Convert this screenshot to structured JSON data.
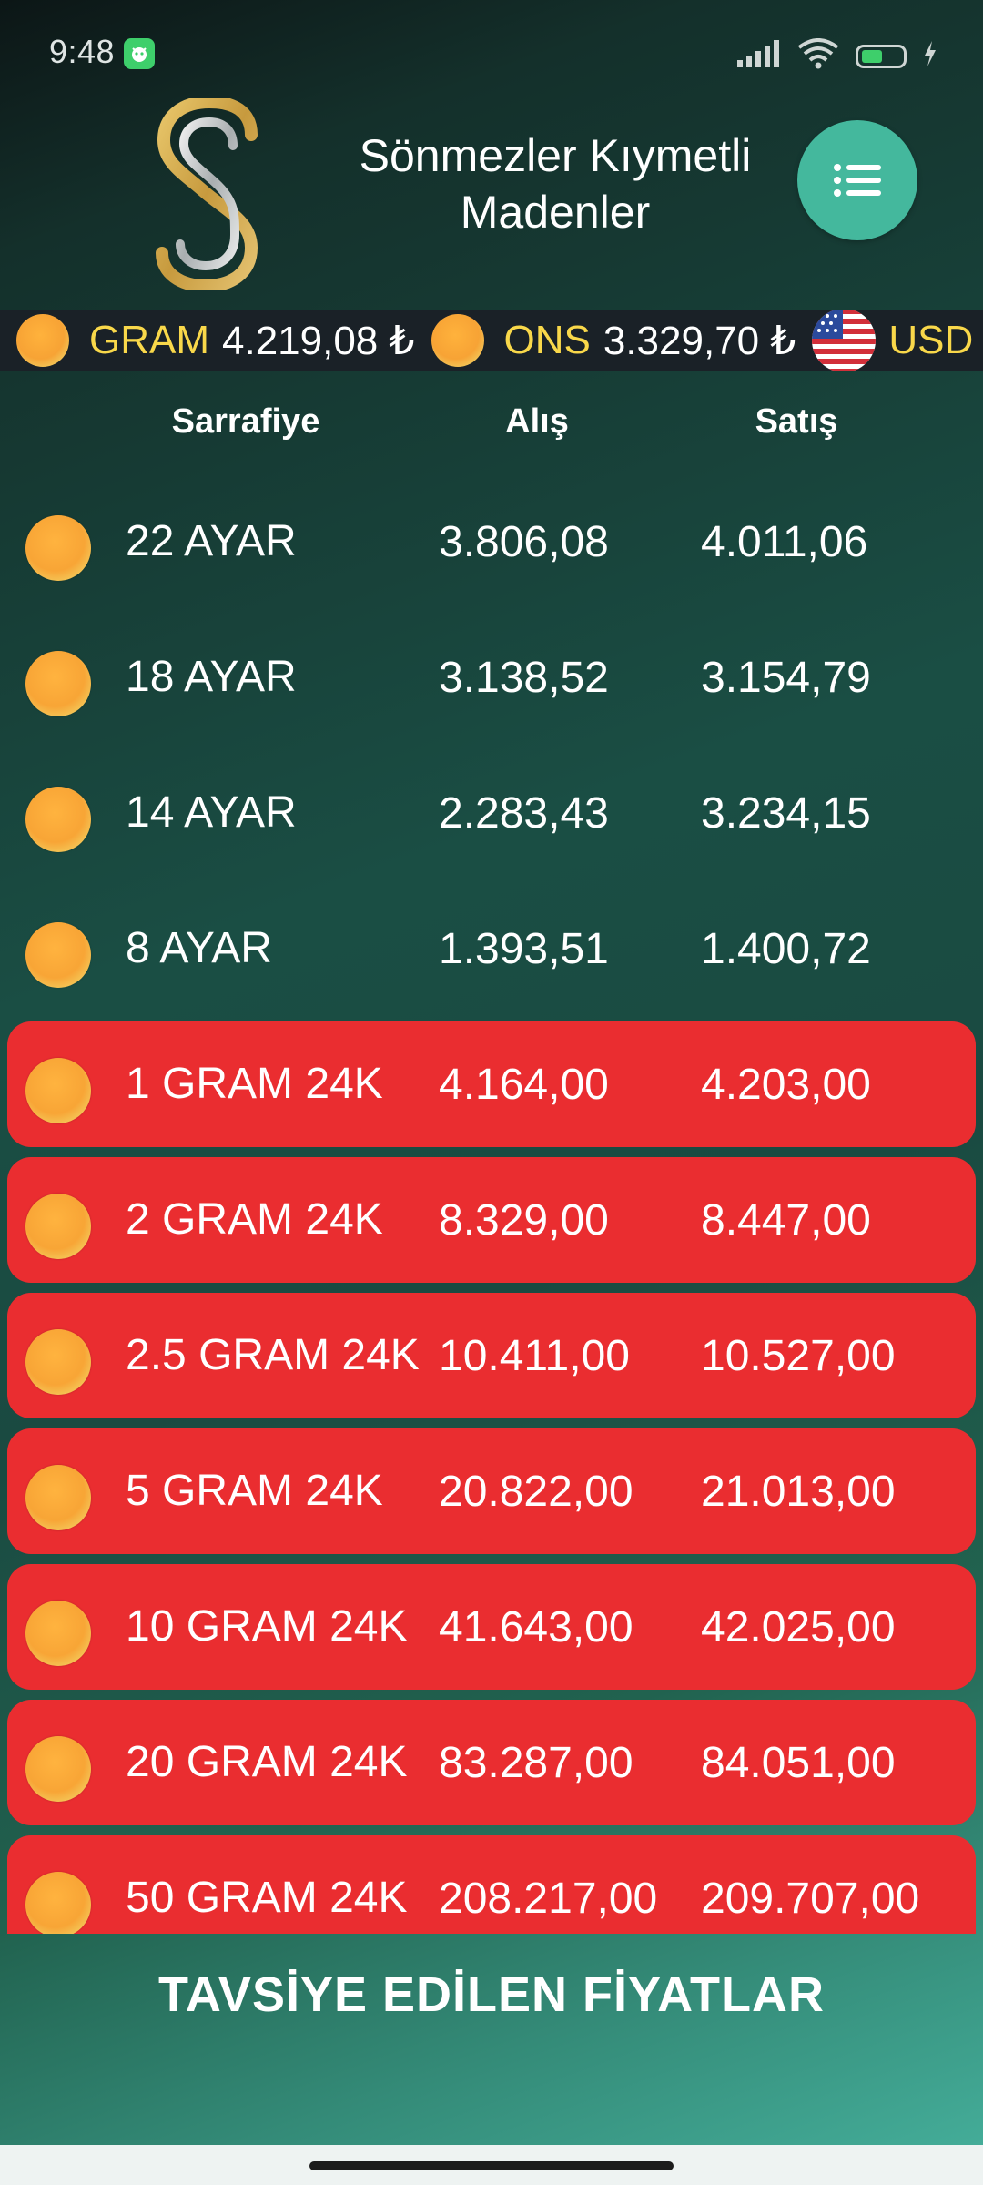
{
  "status_bar": {
    "time": "9:48",
    "battery_level": "40",
    "icons": [
      "app-notification-icon",
      "signal-icon",
      "wifi-icon",
      "battery-icon",
      "charging-icon"
    ]
  },
  "header": {
    "title": "Sönmezler Kıymetli Madenler",
    "menu_icon": "list-menu-icon",
    "accent_color": "#44b89d"
  },
  "ticker": [
    {
      "icon": "gold-coin-icon",
      "label": "GRAM",
      "value": "4.219,08 ₺"
    },
    {
      "icon": "gold-coin-icon",
      "label": "ONS",
      "value": "3.329,70 ₺"
    },
    {
      "icon": "us-flag-icon",
      "label": "USD",
      "value": ""
    }
  ],
  "columns": {
    "name": "Sarrafiye",
    "buy": "Alış",
    "sell": "Satış"
  },
  "rows": [
    {
      "name": "22 AYAR",
      "buy": "3.806,08",
      "sell": "4.011,06",
      "highlight": false
    },
    {
      "name": "18 AYAR",
      "buy": "3.138,52",
      "sell": "3.154,79",
      "highlight": false
    },
    {
      "name": "14 AYAR",
      "buy": "2.283,43",
      "sell": "3.234,15",
      "highlight": false
    },
    {
      "name": "8 AYAR",
      "buy": "1.393,51",
      "sell": "1.400,72",
      "highlight": false
    },
    {
      "name": "1 GRAM 24K",
      "buy": "4.164,00",
      "sell": "4.203,00",
      "highlight": true
    },
    {
      "name": "2 GRAM 24K",
      "buy": "8.329,00",
      "sell": "8.447,00",
      "highlight": true
    },
    {
      "name": "2.5 GRAM 24K",
      "buy": "10.411,00",
      "sell": "10.527,00",
      "highlight": true
    },
    {
      "name": "5 GRAM 24K",
      "buy": "20.822,00",
      "sell": "21.013,00",
      "highlight": true
    },
    {
      "name": "10 GRAM 24K",
      "buy": "41.643,00",
      "sell": "42.025,00",
      "highlight": true
    },
    {
      "name": "20 GRAM 24K",
      "buy": "83.287,00",
      "sell": "84.051,00",
      "highlight": true
    },
    {
      "name": "50 GRAM 24K",
      "buy": "208.217,00",
      "sell": "209.707,00",
      "highlight": true
    }
  ],
  "footer": {
    "title": "TAVSİYE EDİLEN FİYATLAR"
  },
  "colors": {
    "highlight_row": "#ea2d30",
    "ticker_label": "#f9d84a",
    "coin": "#f7a335"
  }
}
